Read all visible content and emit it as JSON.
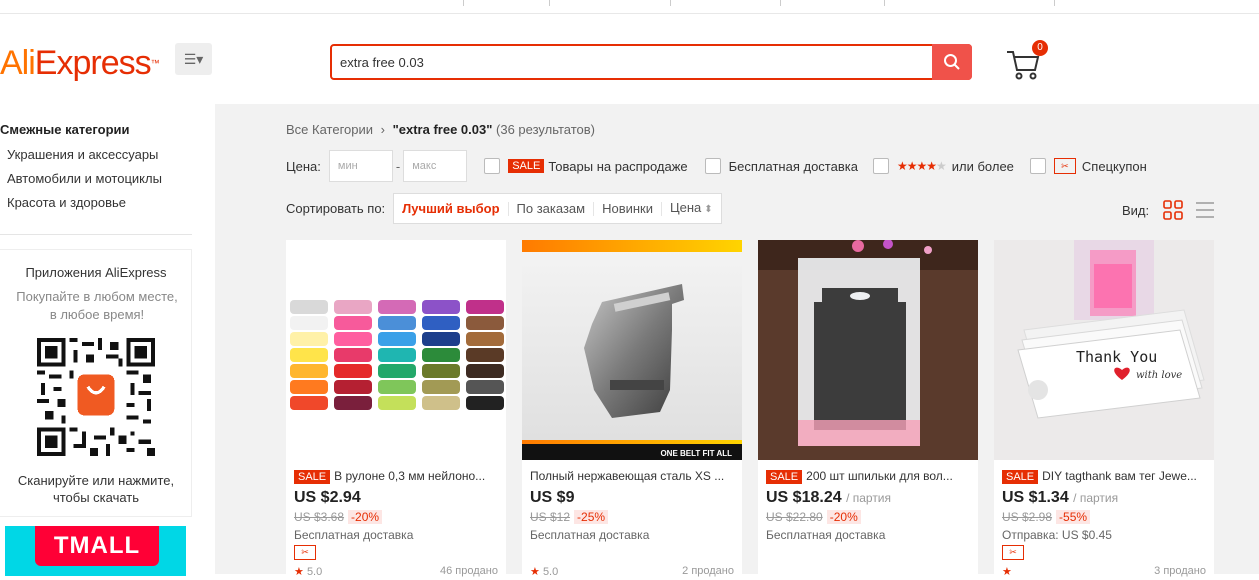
{
  "header": {
    "logo_ali": "Ali",
    "logo_express": "Express",
    "logo_tm": "™",
    "search_value": "extra free 0.03",
    "cart_count": "0"
  },
  "sidebar": {
    "title": "Смежные категории",
    "items": [
      "Украшения и аксессуары",
      "Автомобили и мотоциклы",
      "Красота и здоровье"
    ],
    "app_title": "Приложения AliExpress",
    "app_sub": "Покупайте в любом месте, в любое время!",
    "app_scan": "Сканируйте или нажмите, чтобы скачать",
    "tmall": "TMALL"
  },
  "breadcrumb": {
    "root": "Все Категории",
    "sep": "›",
    "query": "\"extra free 0.03\"",
    "count": "(36 результатов)"
  },
  "filters": {
    "price_label": "Цена:",
    "min_placeholder": "мин",
    "dash": "-",
    "max_placeholder": "макс",
    "sale_tag": "SALE",
    "sale_label": "Товары на распродаже",
    "free_ship_label": "Бесплатная доставка",
    "rating_label": "или более",
    "coupon_label": "Спецкупон",
    "rating_stars": 4
  },
  "sort": {
    "label": "Сортировать по:",
    "options": [
      "Лучший выбор",
      "По заказам",
      "Новинки",
      "Цена"
    ],
    "view_label": "Вид:"
  },
  "products": [
    {
      "sale": "SALE",
      "title": "В рулоне 0,3 мм нейлоно...",
      "price": "US $2.94",
      "unit": "",
      "old_price": "US $3.68",
      "discount": "-20%",
      "shipping": "Бесплатная доставка",
      "rating": "5.0",
      "sold": "46 продано"
    },
    {
      "sale": "",
      "title": "Полный нержавеющая сталь XS ...",
      "price": "US $9",
      "unit": "",
      "old_price": "US $12",
      "discount": "-25%",
      "shipping": "Бесплатная доставка",
      "rating": "5.0",
      "sold": "2 продано",
      "image_text": "ONE BELT FIT ALL"
    },
    {
      "sale": "SALE",
      "title": "200 шт шпильки для вол...",
      "price": "US $18.24",
      "unit": "/ партия",
      "old_price": "US $22.80",
      "discount": "-20%",
      "shipping": "Бесплатная доставка",
      "rating": "",
      "sold": ""
    },
    {
      "sale": "SALE",
      "title": "DIY tagthank вам тег Jewe...",
      "price": "US $1.34",
      "unit": "/ партия",
      "old_price": "US $2.98",
      "discount": "-55%",
      "shipping": "Отправка: US $0.45",
      "rating": "",
      "sold": "3 продано",
      "image_text_1": "Thank You",
      "image_text_2": "with love"
    }
  ],
  "colors": {
    "accent": "#e62e04",
    "search_btn": "#f0524a",
    "logo_orange": "#ff7300"
  }
}
